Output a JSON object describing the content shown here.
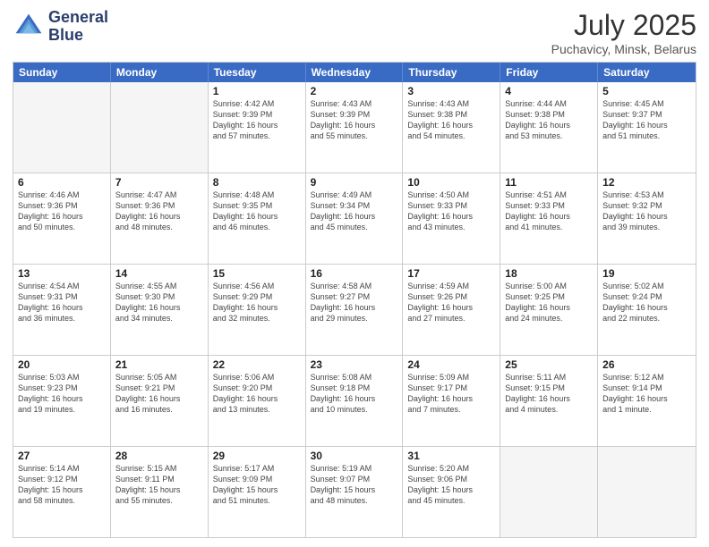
{
  "header": {
    "logo_line1": "General",
    "logo_line2": "Blue",
    "month_year": "July 2025",
    "location": "Puchavicy, Minsk, Belarus"
  },
  "days_of_week": [
    "Sunday",
    "Monday",
    "Tuesday",
    "Wednesday",
    "Thursday",
    "Friday",
    "Saturday"
  ],
  "weeks": [
    [
      {
        "day": "",
        "info": ""
      },
      {
        "day": "",
        "info": ""
      },
      {
        "day": "1",
        "info": "Sunrise: 4:42 AM\nSunset: 9:39 PM\nDaylight: 16 hours\nand 57 minutes."
      },
      {
        "day": "2",
        "info": "Sunrise: 4:43 AM\nSunset: 9:39 PM\nDaylight: 16 hours\nand 55 minutes."
      },
      {
        "day": "3",
        "info": "Sunrise: 4:43 AM\nSunset: 9:38 PM\nDaylight: 16 hours\nand 54 minutes."
      },
      {
        "day": "4",
        "info": "Sunrise: 4:44 AM\nSunset: 9:38 PM\nDaylight: 16 hours\nand 53 minutes."
      },
      {
        "day": "5",
        "info": "Sunrise: 4:45 AM\nSunset: 9:37 PM\nDaylight: 16 hours\nand 51 minutes."
      }
    ],
    [
      {
        "day": "6",
        "info": "Sunrise: 4:46 AM\nSunset: 9:36 PM\nDaylight: 16 hours\nand 50 minutes."
      },
      {
        "day": "7",
        "info": "Sunrise: 4:47 AM\nSunset: 9:36 PM\nDaylight: 16 hours\nand 48 minutes."
      },
      {
        "day": "8",
        "info": "Sunrise: 4:48 AM\nSunset: 9:35 PM\nDaylight: 16 hours\nand 46 minutes."
      },
      {
        "day": "9",
        "info": "Sunrise: 4:49 AM\nSunset: 9:34 PM\nDaylight: 16 hours\nand 45 minutes."
      },
      {
        "day": "10",
        "info": "Sunrise: 4:50 AM\nSunset: 9:33 PM\nDaylight: 16 hours\nand 43 minutes."
      },
      {
        "day": "11",
        "info": "Sunrise: 4:51 AM\nSunset: 9:33 PM\nDaylight: 16 hours\nand 41 minutes."
      },
      {
        "day": "12",
        "info": "Sunrise: 4:53 AM\nSunset: 9:32 PM\nDaylight: 16 hours\nand 39 minutes."
      }
    ],
    [
      {
        "day": "13",
        "info": "Sunrise: 4:54 AM\nSunset: 9:31 PM\nDaylight: 16 hours\nand 36 minutes."
      },
      {
        "day": "14",
        "info": "Sunrise: 4:55 AM\nSunset: 9:30 PM\nDaylight: 16 hours\nand 34 minutes."
      },
      {
        "day": "15",
        "info": "Sunrise: 4:56 AM\nSunset: 9:29 PM\nDaylight: 16 hours\nand 32 minutes."
      },
      {
        "day": "16",
        "info": "Sunrise: 4:58 AM\nSunset: 9:27 PM\nDaylight: 16 hours\nand 29 minutes."
      },
      {
        "day": "17",
        "info": "Sunrise: 4:59 AM\nSunset: 9:26 PM\nDaylight: 16 hours\nand 27 minutes."
      },
      {
        "day": "18",
        "info": "Sunrise: 5:00 AM\nSunset: 9:25 PM\nDaylight: 16 hours\nand 24 minutes."
      },
      {
        "day": "19",
        "info": "Sunrise: 5:02 AM\nSunset: 9:24 PM\nDaylight: 16 hours\nand 22 minutes."
      }
    ],
    [
      {
        "day": "20",
        "info": "Sunrise: 5:03 AM\nSunset: 9:23 PM\nDaylight: 16 hours\nand 19 minutes."
      },
      {
        "day": "21",
        "info": "Sunrise: 5:05 AM\nSunset: 9:21 PM\nDaylight: 16 hours\nand 16 minutes."
      },
      {
        "day": "22",
        "info": "Sunrise: 5:06 AM\nSunset: 9:20 PM\nDaylight: 16 hours\nand 13 minutes."
      },
      {
        "day": "23",
        "info": "Sunrise: 5:08 AM\nSunset: 9:18 PM\nDaylight: 16 hours\nand 10 minutes."
      },
      {
        "day": "24",
        "info": "Sunrise: 5:09 AM\nSunset: 9:17 PM\nDaylight: 16 hours\nand 7 minutes."
      },
      {
        "day": "25",
        "info": "Sunrise: 5:11 AM\nSunset: 9:15 PM\nDaylight: 16 hours\nand 4 minutes."
      },
      {
        "day": "26",
        "info": "Sunrise: 5:12 AM\nSunset: 9:14 PM\nDaylight: 16 hours\nand 1 minute."
      }
    ],
    [
      {
        "day": "27",
        "info": "Sunrise: 5:14 AM\nSunset: 9:12 PM\nDaylight: 15 hours\nand 58 minutes."
      },
      {
        "day": "28",
        "info": "Sunrise: 5:15 AM\nSunset: 9:11 PM\nDaylight: 15 hours\nand 55 minutes."
      },
      {
        "day": "29",
        "info": "Sunrise: 5:17 AM\nSunset: 9:09 PM\nDaylight: 15 hours\nand 51 minutes."
      },
      {
        "day": "30",
        "info": "Sunrise: 5:19 AM\nSunset: 9:07 PM\nDaylight: 15 hours\nand 48 minutes."
      },
      {
        "day": "31",
        "info": "Sunrise: 5:20 AM\nSunset: 9:06 PM\nDaylight: 15 hours\nand 45 minutes."
      },
      {
        "day": "",
        "info": ""
      },
      {
        "day": "",
        "info": ""
      }
    ]
  ]
}
